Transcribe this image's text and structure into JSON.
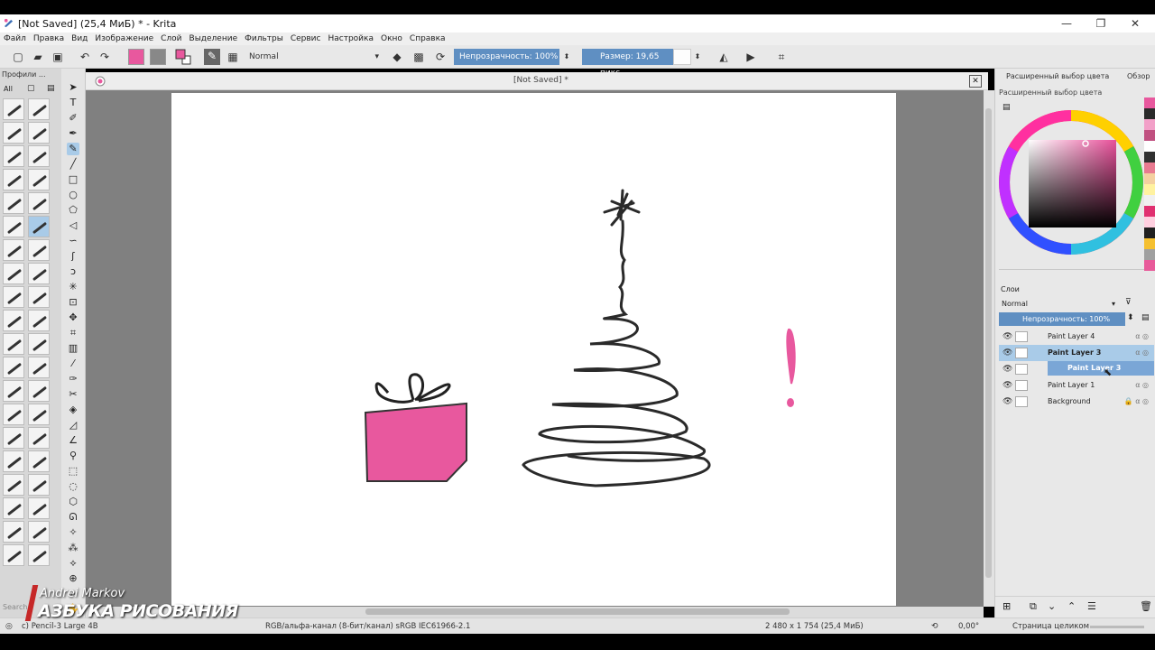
{
  "window": {
    "title": "[Not Saved]  (25,4 МиБ)  * - Krita",
    "minimize": "—",
    "maximize": "❐",
    "close": "✕"
  },
  "menu": [
    "Файл",
    "Правка",
    "Вид",
    "Изображение",
    "Слой",
    "Выделение",
    "Фильтры",
    "Сервис",
    "Настройка",
    "Окно",
    "Справка"
  ],
  "toolbar": {
    "blend_mode": "Normal",
    "opacity_label": "Непрозрачность: 100%",
    "size_label": "Размер: 19,65 пикс."
  },
  "left_dock": {
    "header": "Профили ...",
    "filter": "All",
    "search_placeholder": "Search"
  },
  "canvas": {
    "tab_title": "[Not Saved]  *",
    "close": "✕"
  },
  "right_dock": {
    "tab_advanced_color": "Расширенный выбор цвета",
    "tab_overview": "Обзор",
    "color_panel_title": "Расширенный выбор цвета",
    "layers_title": "Слои",
    "layers_blend": "Normal",
    "layers_opacity": "Непрозрачность:  100%",
    "drag_label": "Paint Layer 3",
    "layers": [
      {
        "name": "Paint Layer 4",
        "selected": false,
        "locked": false
      },
      {
        "name": "Paint Layer 3",
        "selected": true,
        "locked": false
      },
      {
        "name": "",
        "selected": false,
        "locked": false
      },
      {
        "name": "Paint Layer 1",
        "selected": false,
        "locked": false
      },
      {
        "name": "Background",
        "selected": false,
        "locked": true
      }
    ]
  },
  "status": {
    "brush": "c) Pencil-3 Large 4B",
    "color_space": "RGB/альфа-канал (8-бит/канал)  sRGB IEC61966-2.1",
    "dimensions": "2 480 x 1 754 (25,4 МиБ)",
    "rotation": "0,00°",
    "zoom": "Страница целиком"
  },
  "watermark": {
    "author": "Andrei Markov",
    "brand": "АЗБУКА РИСОВАНИЯ"
  },
  "colors": {
    "accent": "#5f8fc2",
    "foreground_pink": "#e8589e",
    "selection_blue": "#a9cbe8",
    "palette": [
      "#e8589e",
      "#2a2a2a",
      "#f2a0c8",
      "#c05080",
      "#ffffff",
      "#303030",
      "#e87a90",
      "#f4d0a0",
      "#fff2a0",
      "#f0f0f0",
      "#e03070",
      "#ffd0e0",
      "#202020",
      "#f5c030",
      "#a0a0a0",
      "#e85a9a"
    ]
  }
}
